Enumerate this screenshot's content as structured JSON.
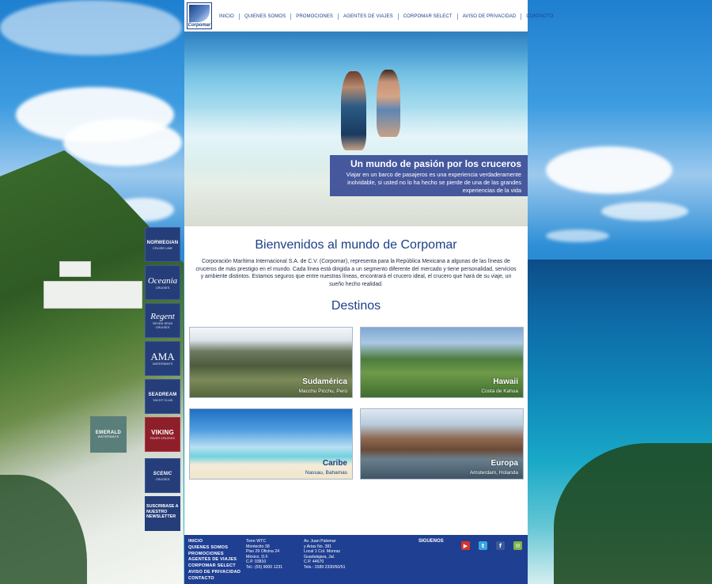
{
  "nav": {
    "logo_text": "Corpomar",
    "items": [
      {
        "label": "INICIO"
      },
      {
        "label": "QUIENES SOMOS"
      },
      {
        "label": "PROMOCIONES"
      },
      {
        "label": "AGENTES DE VIAJES"
      },
      {
        "label": "CORPOMAR SELECT"
      },
      {
        "label": "AVISO DE PRIVACIDAD"
      },
      {
        "label": "CONTACTO"
      }
    ]
  },
  "hero": {
    "title": "Un mundo de pasión por los cruceros",
    "text": "Viajar en un barco de pasajeros es una experiencia verdaderamente inolvidable, si usted no lo ha hecho se pierde de una de las grandes experiencias de la vida"
  },
  "welcome": {
    "title": "Bienvenidos al mundo de Corpomar",
    "text": "Corporación Marítima Internacional S.A. de C.V. (Corpomar), representa para la República Mexicana a algunas de las líneas de cruceros de más prestigio en el mundo. Cada línea está dirigida a un segmento diferente del mercado y tiene personalidad, servicios y ambiente distintos. Estamos seguros que entre nuestras líneas, encontrará el crucero ideal, el crucero que hará de su viaje, un sueño hecho realidad."
  },
  "destinos": {
    "title": "Destinos",
    "cards": [
      {
        "title": "Sudamérica",
        "subtitle": "Macchu Picchu, Perú"
      },
      {
        "title": "Hawaii",
        "subtitle": "Costa de Kahua"
      },
      {
        "title": "Caribe",
        "subtitle": "Nassau, Bahamas"
      },
      {
        "title": "Europa",
        "subtitle": "Amsterdam, Holanda"
      }
    ]
  },
  "brands": [
    {
      "main": "NORWEGIAN",
      "sub": "CRUISE LINE"
    },
    {
      "main": "Oceania",
      "sub": "CRUISES"
    },
    {
      "main": "Regent",
      "sub": "SEVEN SEAS CRUISES"
    },
    {
      "main": "AMA",
      "sub": "WATERWAYS"
    },
    {
      "main": "SEADREAM",
      "sub": "YACHT CLUB"
    },
    {
      "main": "VIKING",
      "sub": "RIVER CRUISES"
    },
    {
      "main": "SCENIC",
      "sub": "CRUISES"
    }
  ],
  "emerald": {
    "main": "EMERALD",
    "sub": "WATERWAYS"
  },
  "newsletter": {
    "label": "SUSCRIBASE A NUESTRO NEWSLETTER"
  },
  "footer": {
    "nav": [
      "INICIO",
      "QUIENES SOMOS",
      "PROMOCIONES",
      "AGENTES DE VIAJES",
      "CORPOMAR SELECT",
      "AVISO DE PRIVACIDAD",
      "CONTACTO"
    ],
    "address1": [
      "Torre WTC",
      "Montecito 38",
      "Piso 29 Oficina 24",
      "México, D.F.",
      "C.P. 03810",
      "Tel.: (55) 9000 1231"
    ],
    "address2": [
      "Av. Juan Palomar",
      "y Arias No. 381",
      "Local 1 Col. Monraz",
      "Guadalajara, Jal.",
      "C.P. 44670",
      "Tels.: 1589 2330/50/51"
    ],
    "follow_label": "SIGUENOS",
    "social": [
      {
        "icon": "youtube-icon",
        "glyph": "▶",
        "color": "#d9322b"
      },
      {
        "icon": "twitter-icon",
        "glyph": "t",
        "color": "#3aa5e0"
      },
      {
        "icon": "facebook-icon",
        "glyph": "f",
        "color": "#3b5998"
      },
      {
        "icon": "email-icon",
        "glyph": "✉",
        "color": "#7ab648"
      }
    ]
  },
  "colors": {
    "brand_blue": "#1c3f88",
    "footer_blue": "#1f3f93"
  }
}
